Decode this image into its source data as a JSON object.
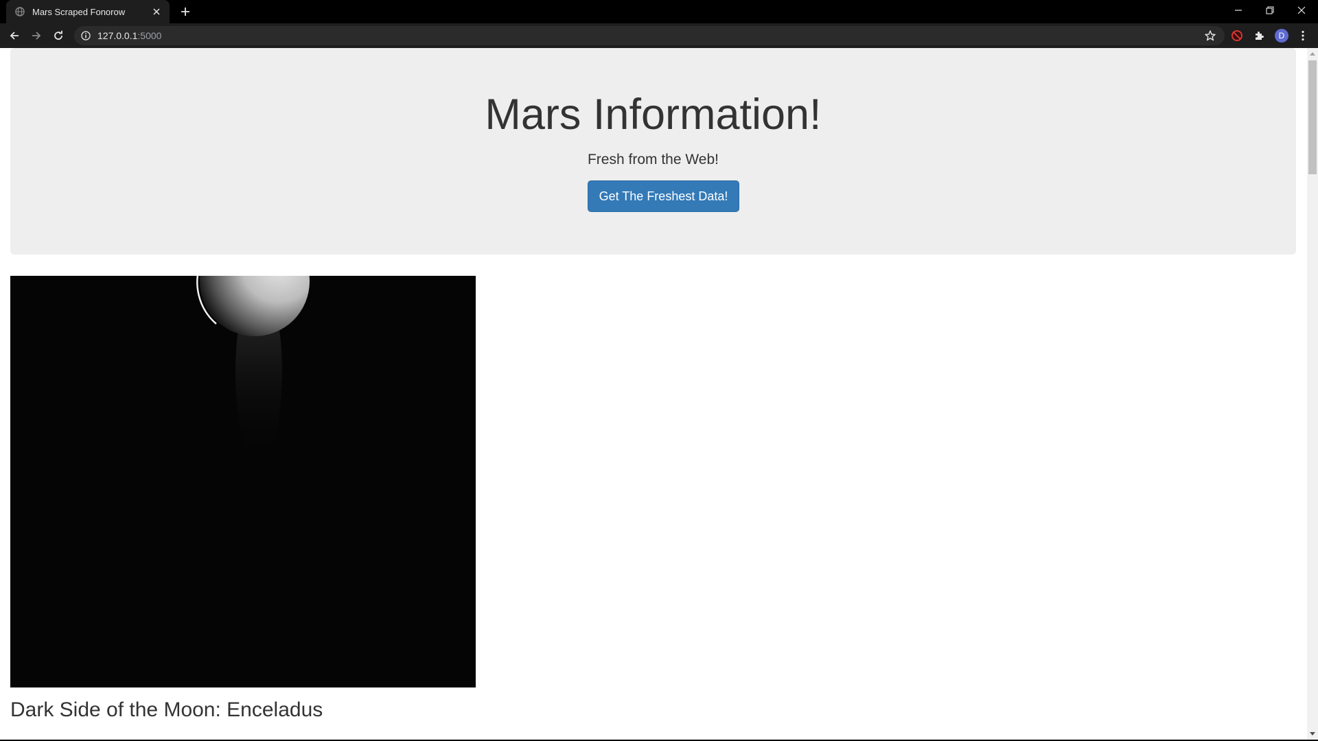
{
  "browser": {
    "tab": {
      "title": "Mars Scraped Fonorow",
      "favicon": "globe-icon"
    },
    "address": {
      "host": "127.0.0.1",
      "port": ":5000"
    },
    "profile_initial": "D",
    "accent": "#5f6bd1"
  },
  "page": {
    "jumbotron": {
      "title": "Mars Information!",
      "subtitle": "Fresh from the Web!",
      "button_label": "Get The Freshest Data!",
      "button_color": "#337ab7"
    },
    "featured": {
      "image_icon": "moon-image",
      "title": "Dark Side of the Moon: Enceladus"
    }
  }
}
